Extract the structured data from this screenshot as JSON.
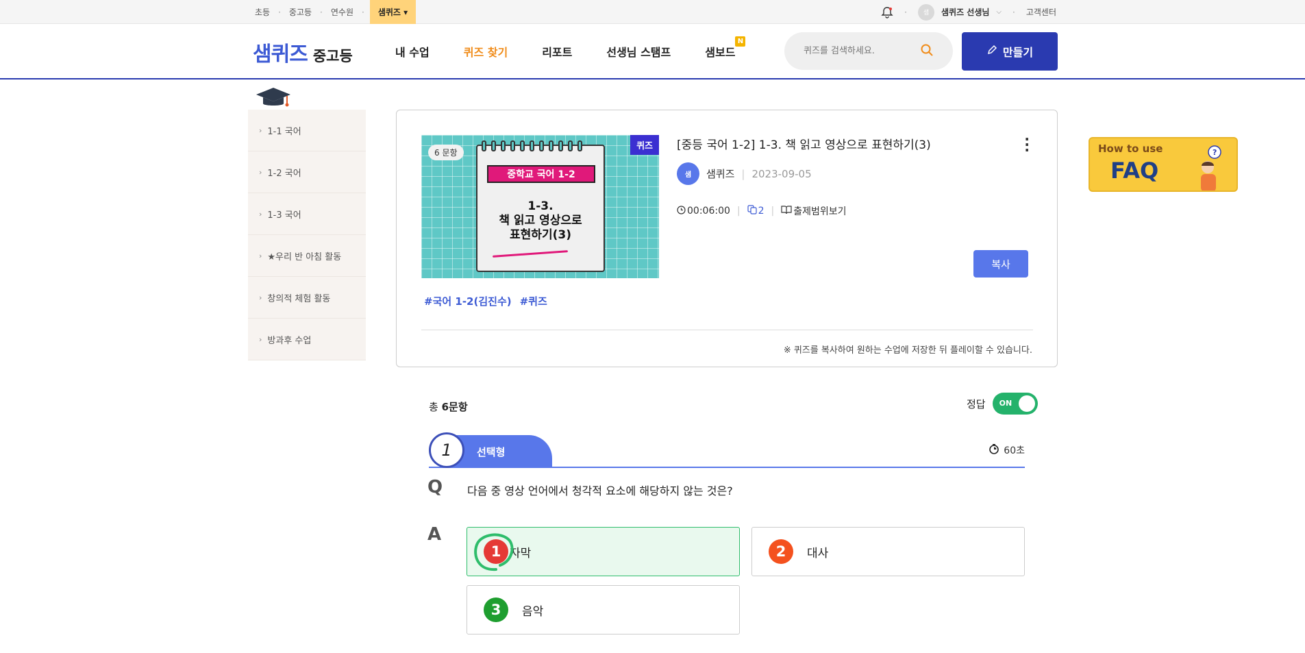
{
  "topbar": {
    "links": [
      "초등",
      "중고등",
      "연수원"
    ],
    "active_tab": "샘퀴즈",
    "teacher": "샘퀴즈 선생님",
    "avatar_text": "샘",
    "help": "고객센터"
  },
  "header": {
    "brand": "샘퀴즈",
    "sub": "중고등",
    "nav": [
      "내 수업",
      "퀴즈 찾기",
      "리포트",
      "선생님 스탬프",
      "샘보드"
    ],
    "nav_badge": "N",
    "search_placeholder": "퀴즈를 검색하세요.",
    "make_label": "만들기"
  },
  "sidebar": {
    "items": [
      "1-1 국어",
      "1-2 국어",
      "1-3 국어",
      "★우리 반 아침 활동",
      "창의적 체험 활동",
      "방과후 수업"
    ]
  },
  "quiz": {
    "count_badge": "6 문항",
    "type_tag": "퀴즈",
    "thumb_title": "중학교 국어 1-2",
    "thumb_line1": "1-3.",
    "thumb_line2": "책 읽고 영상으로",
    "thumb_line3": "표현하기(3)",
    "title": "[중등 국어 1-2] 1-3. 책 읽고 영상으로 표현하기(3)",
    "author": "샘퀴즈",
    "author_avatar": "샘",
    "date": "2023-09-05",
    "duration": "00:06:00",
    "copies": "2",
    "scope": "출제범위보기",
    "copy_label": "복사",
    "tags": [
      "#국어 1-2(김진수)",
      "#퀴즈"
    ],
    "note": "※ 퀴즈를 복사하여 원하는 수업에 저장한 뒤 플레이할 수 있습니다."
  },
  "faq": {
    "how": "How to use",
    "big": "FAQ"
  },
  "questions": {
    "total_prefix": "총 ",
    "total": "6문항",
    "answer_label": "정답",
    "toggle": "ON",
    "number": "1",
    "type": "선택형",
    "time": "60초",
    "q_letter": "Q",
    "a_letter": "A",
    "text": "다음 중 영상 언어에서 청각적 요소에 해당하지 않는 것은?",
    "options": [
      {
        "num": "1",
        "label": "자막",
        "color": "#e53935"
      },
      {
        "num": "2",
        "label": "대사",
        "color": "#f4511e"
      },
      {
        "num": "3",
        "label": "음악",
        "color": "#1e9e2f"
      }
    ]
  }
}
